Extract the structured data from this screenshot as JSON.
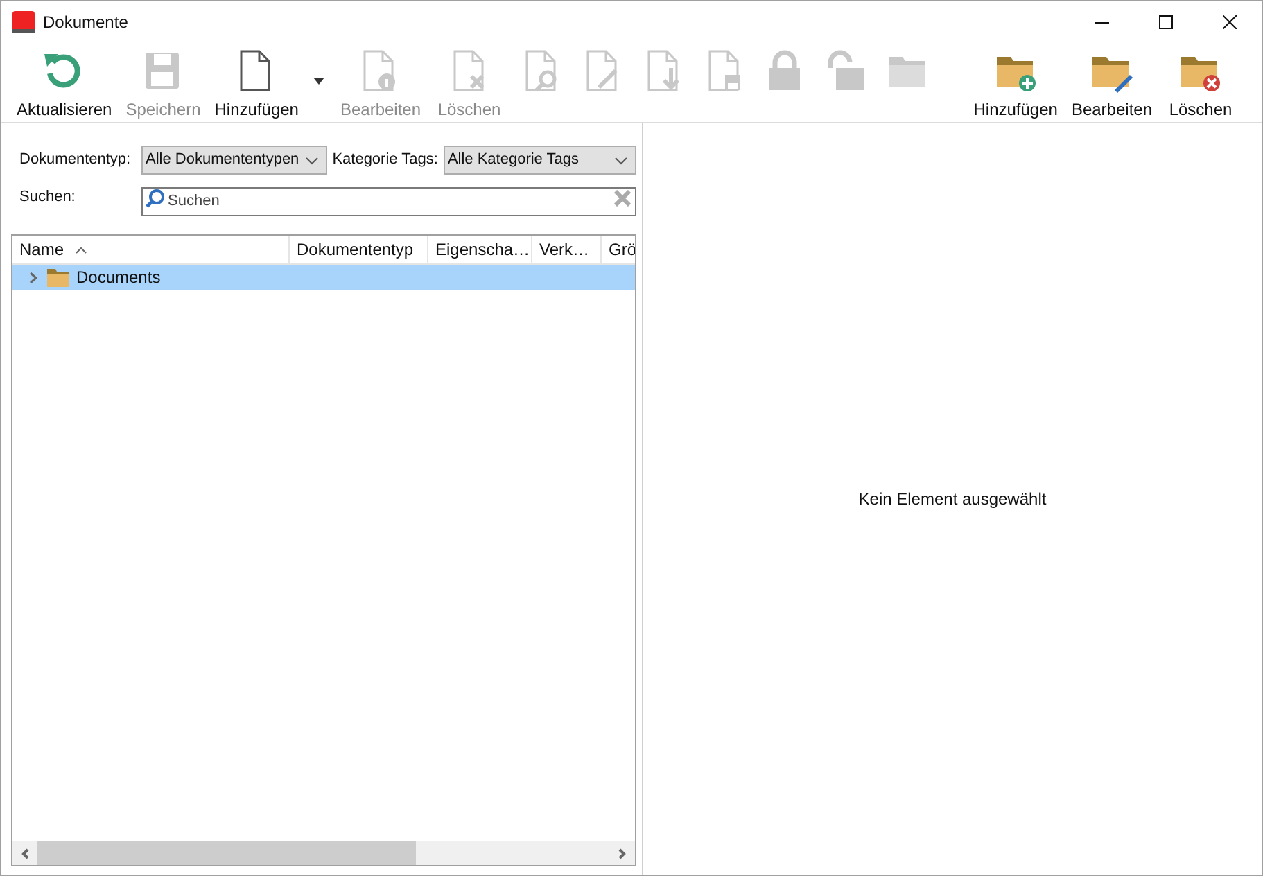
{
  "window": {
    "title": "Dokumente"
  },
  "toolbar": [
    {
      "kind": "refresh",
      "label": "Aktualisieren",
      "disabled": false
    },
    {
      "kind": "save",
      "label": "Speichern",
      "disabled": true
    },
    {
      "kind": "add-doc",
      "label": "Hinzufügen",
      "disabled": false,
      "dropdown": true
    },
    {
      "kind": "doc-info",
      "label": "Bearbeiten",
      "disabled": true
    },
    {
      "kind": "doc-delete",
      "label": "Löschen",
      "disabled": true
    },
    {
      "kind": "doc-search",
      "disabled": true
    },
    {
      "kind": "doc-edit",
      "disabled": true
    },
    {
      "kind": "doc-down",
      "disabled": true
    },
    {
      "kind": "doc-save",
      "disabled": true
    },
    {
      "kind": "lock",
      "disabled": true
    },
    {
      "kind": "unlock",
      "disabled": true
    },
    {
      "kind": "folder",
      "disabled": true
    }
  ],
  "folder_toolbar": [
    {
      "kind": "folder-add",
      "label": "Hinzufügen",
      "disabled": false
    },
    {
      "kind": "folder-edit",
      "label": "Bearbeiten",
      "disabled": false
    },
    {
      "kind": "folder-delete",
      "label": "Löschen",
      "disabled": false
    }
  ],
  "filters": {
    "doctype_label": "Dokumententyp:",
    "doctype_value": "Alle Dokumententypen",
    "tags_label": "Kategorie Tags:",
    "tags_value": "Alle Kategorie Tags",
    "search_label": "Suchen:",
    "search_placeholder": "Suchen"
  },
  "table": {
    "columns": [
      {
        "label": "Name",
        "sorted": true
      },
      {
        "label": "Dokumententyp"
      },
      {
        "label": "Eigenscha…"
      },
      {
        "label": "Verk…"
      },
      {
        "label": "Grö"
      }
    ],
    "rows": [
      {
        "name": "Documents",
        "selected": true,
        "expanded": false
      }
    ]
  },
  "detail": {
    "empty_text": "Kein Element ausgewählt"
  }
}
